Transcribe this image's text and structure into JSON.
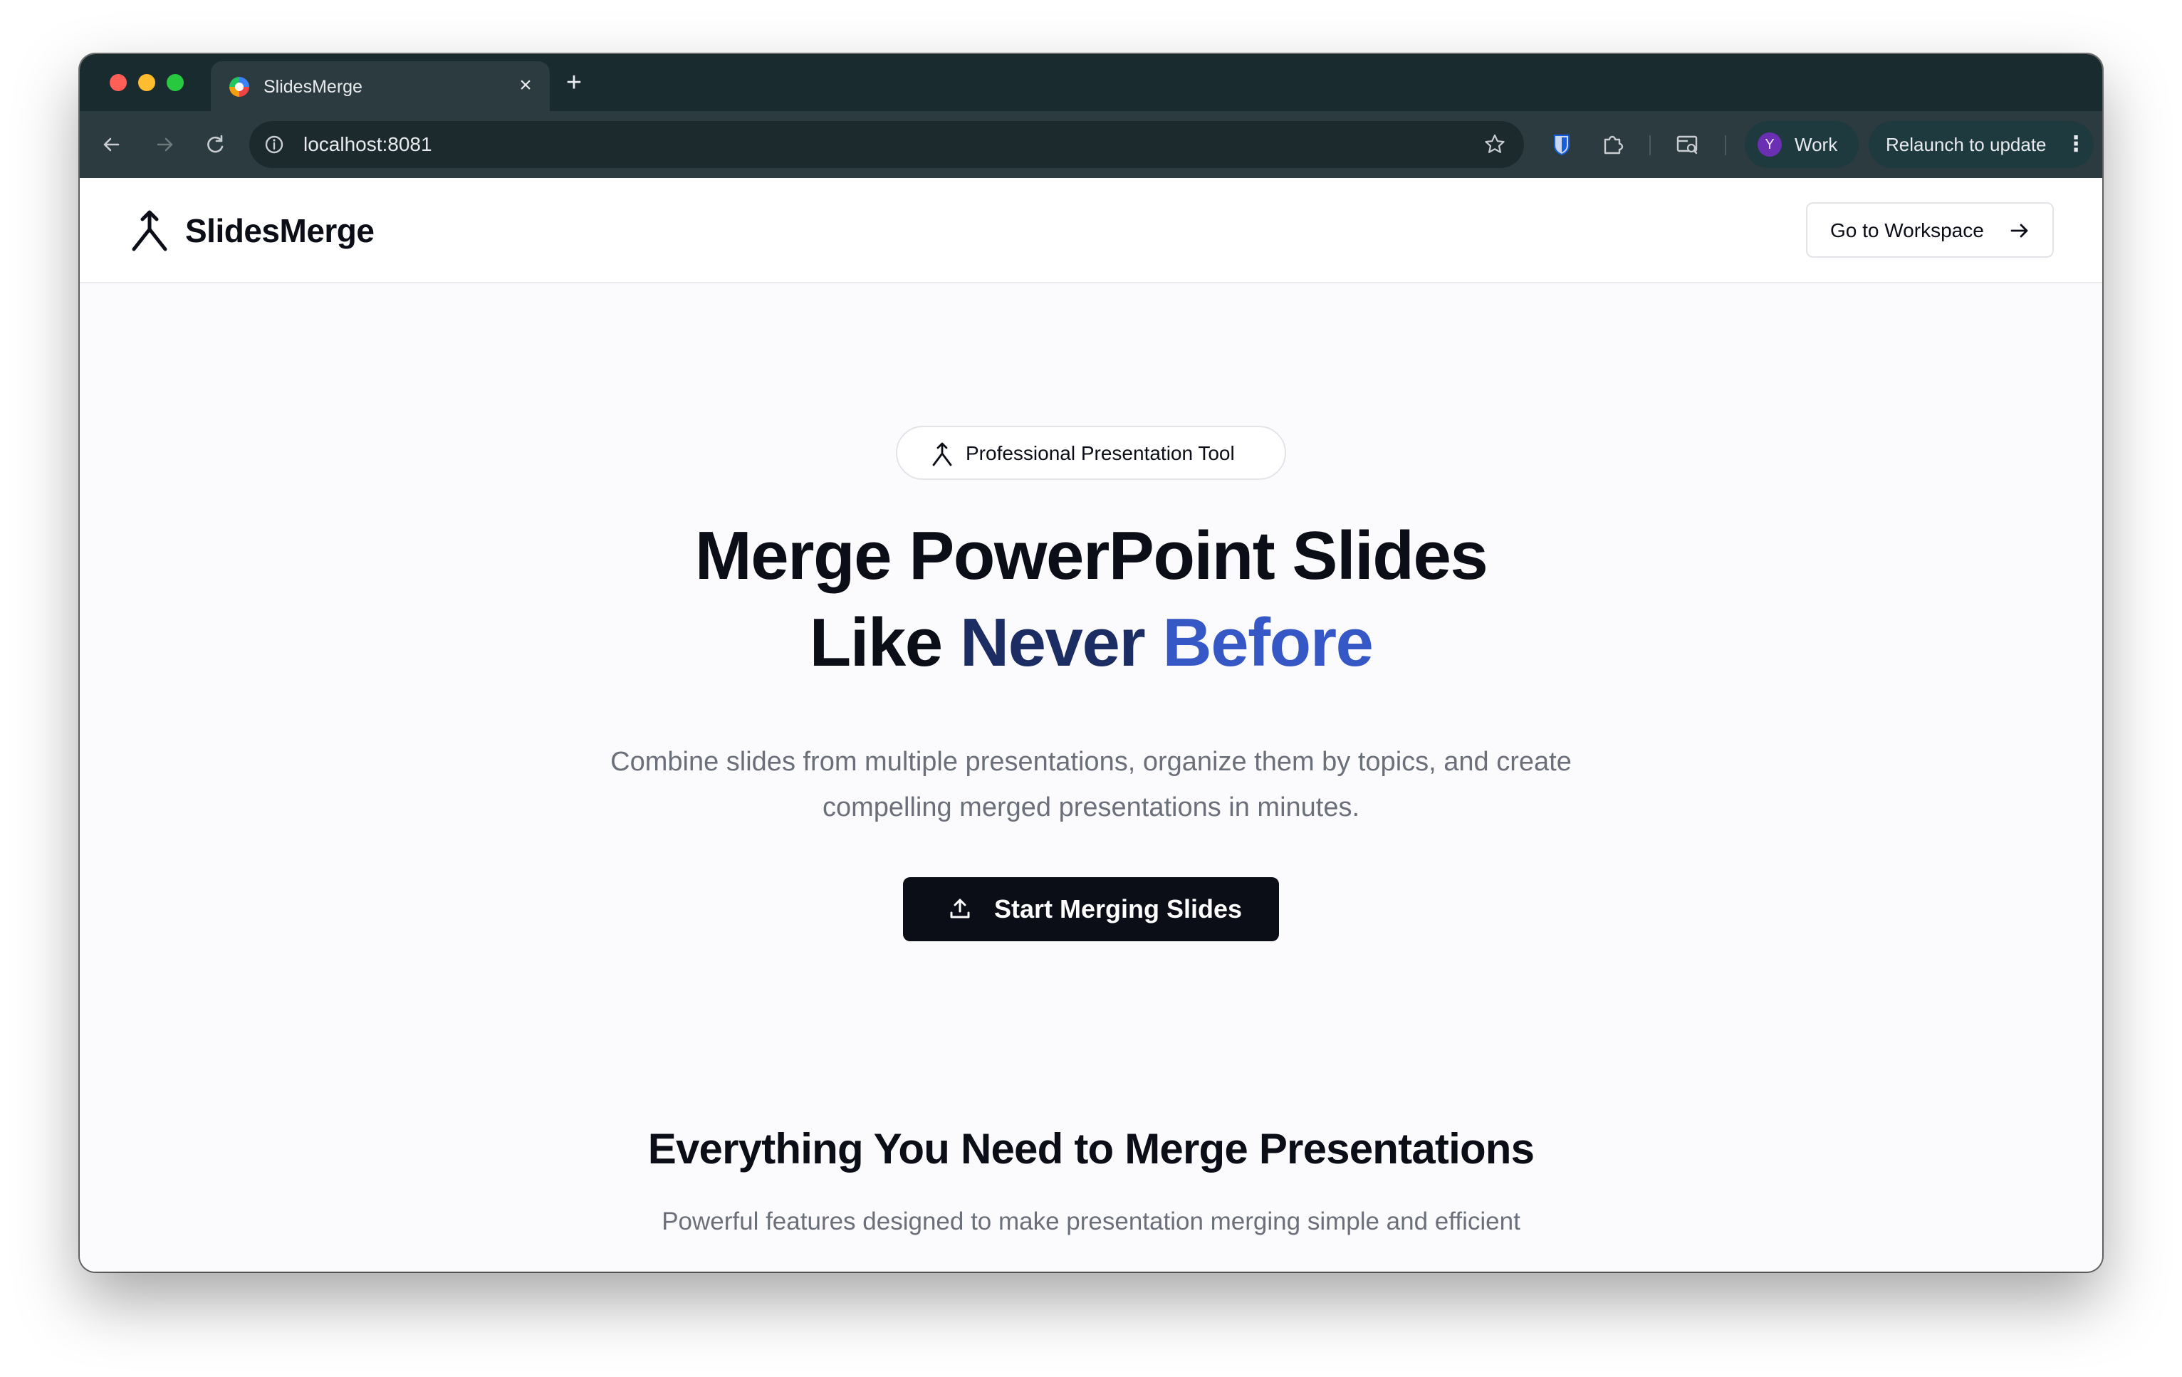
{
  "browser": {
    "tab_title": "SlidesMerge",
    "tab_close": "×",
    "new_tab": "+",
    "url": "localhost:8081",
    "profile_initial": "Y",
    "profile_name": "Work",
    "relaunch_label": "Relaunch to update",
    "menu_glyph": "⋮"
  },
  "header": {
    "brand": "SlidesMerge",
    "workspace_button": "Go to Workspace"
  },
  "hero": {
    "badge": "Professional Presentation Tool",
    "title_line1": "Merge PowerPoint Slides",
    "title_like": "Like",
    "title_never": "Never",
    "title_before": "Before",
    "subtitle": "Combine slides from multiple presentations, organize them by topics, and create compelling merged presentations in minutes.",
    "cta": "Start Merging Slides"
  },
  "features": {
    "title": "Everything You Need to Merge Presentations",
    "subtitle": "Powerful features designed to make presentation merging simple and efficient"
  },
  "colors": {
    "chrome_dark": "#1a2b2f",
    "chrome_toolbar": "#2c3b3f",
    "text_primary": "#0b0d17",
    "text_muted": "#6b6f7a",
    "accent_navy": "#1c2d63",
    "accent_blue": "#3558c6",
    "profile_purple": "#6b2fb3"
  }
}
